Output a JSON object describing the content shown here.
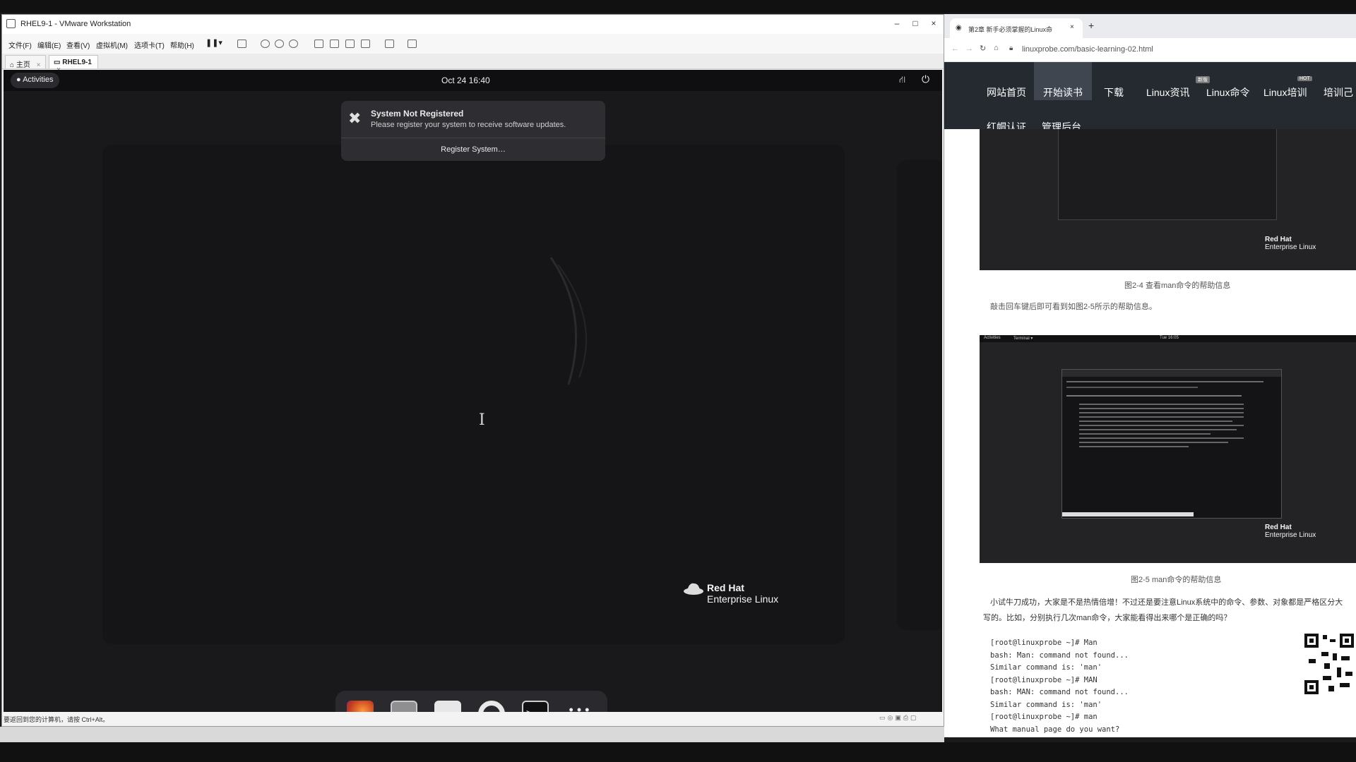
{
  "vmware": {
    "title": "RHEL9-1 - VMware Workstation",
    "menu": [
      "文件(F)",
      "编辑(E)",
      "查看(V)",
      "虚拟机(M)",
      "选项卡(T)",
      "帮助(H)"
    ],
    "tabs": [
      {
        "label": "主页",
        "close": "×"
      },
      {
        "label": "RHEL9-1",
        "close": "×"
      }
    ],
    "status_text": "要返回到您的计算机，请按 Ctrl+Alt。",
    "window_controls": {
      "minimize": "–",
      "maximize": "□",
      "close": "×"
    }
  },
  "guest": {
    "activities": "Activities",
    "clock": "Oct 24  16:40",
    "notification": {
      "title": "System Not Registered",
      "body": "Please register your system to receive software updates.",
      "button": "Register System…",
      "icon": "tools-icon"
    },
    "logo": {
      "line1": "Red Hat",
      "line2": "Enterprise Linux"
    },
    "dock_icons": [
      "firefox-icon",
      "files-icon",
      "software-icon",
      "help-icon",
      "terminal-icon",
      "app-grid-icon"
    ],
    "terminal_prompt": ">_"
  },
  "browser": {
    "tab_title": "第2章 新手必须掌握的Linux命",
    "new_tab": "+",
    "tab_close": "×",
    "url": "linuxprobe.com/basic-learning-02.html",
    "nav": {
      "row1": [
        "网站首页",
        "开始读书",
        "下载",
        "Linux资讯",
        "Linux命令",
        "Linux培训",
        "培训己"
      ],
      "row2": [
        "红帽认证",
        "管理后台"
      ],
      "badges": [
        "新版",
        "HOT"
      ]
    },
    "content": {
      "caption1": "图2-4  查看man命令的帮助信息",
      "para1": "敲击回车键后即可看到如图2-5所示的帮助信息。",
      "caption2": "图2-5  man命令的帮助信息",
      "para2_line1": "小试牛刀成功，大家是不是热情倍增！不过还是要注意Linux系统中的命令、参数、对象都是严格区分大",
      "para2_line2": "写的。比如，分别执行几次man命令，大家能看得出来哪个是正确的吗？",
      "code": [
        "[root@linuxprobe ~]# Man",
        "bash: Man: command not found...",
        "Similar command is: 'man'",
        "[root@linuxprobe ~]# MAN",
        "bash: MAN: command not found...",
        "Similar command is: 'man'",
        "[root@linuxprobe ~]# man",
        "What manual page do you want?"
      ],
      "shot_logo": {
        "line1": "Red Hat",
        "line2": "Enterprise Linux"
      },
      "shot2_topbar": {
        "activities": "Activities",
        "app": "Terminal ▾",
        "clock": "Tue 16:05"
      }
    }
  },
  "colors": {
    "guest_bg": "#19191c",
    "browser_nav": "#252a30",
    "nav_active": "#3f4650"
  }
}
